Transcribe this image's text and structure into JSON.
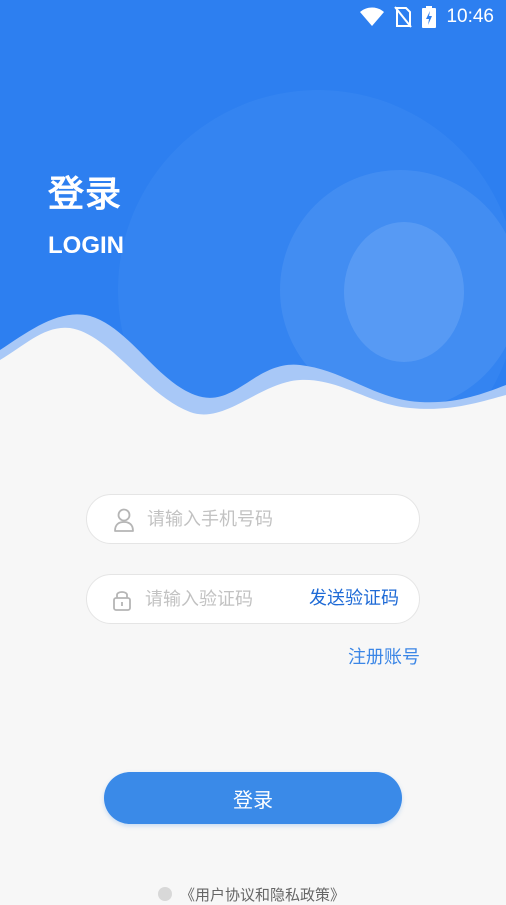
{
  "status_bar": {
    "time": "10:46"
  },
  "header": {
    "title": "登录",
    "subtitle": "LOGIN"
  },
  "form": {
    "phone_placeholder": "请输入手机号码",
    "code_placeholder": "请输入验证码",
    "send_code_label": "发送验证码",
    "register_label": "注册账号",
    "login_label": "登录"
  },
  "agreement": {
    "text": "《用户协议和隐私政策》",
    "checked": false
  },
  "colors": {
    "primary_blue": "#2d7ff0",
    "button_blue": "#3a8ae8",
    "link_blue": "#1e6ad6",
    "background": "#f7f7f7"
  },
  "icons": [
    "wifi-icon",
    "no-sim-icon",
    "battery-charging-icon",
    "user-icon",
    "lock-icon"
  ]
}
